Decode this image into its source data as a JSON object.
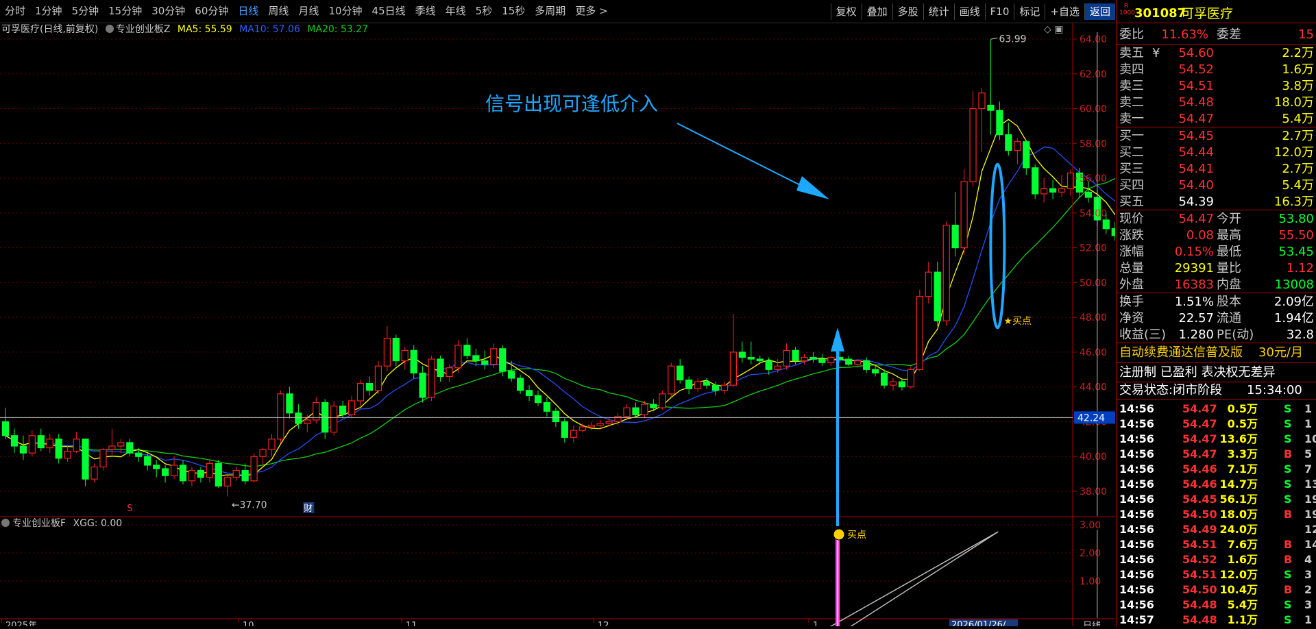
{
  "toolbar": {
    "periods": [
      {
        "label": "分时",
        "active": false
      },
      {
        "label": "1分钟",
        "active": false
      },
      {
        "label": "5分钟",
        "active": false
      },
      {
        "label": "15分钟",
        "active": false
      },
      {
        "label": "30分钟",
        "active": false
      },
      {
        "label": "60分钟",
        "active": false
      },
      {
        "label": "日线",
        "active": true
      },
      {
        "label": "周线",
        "active": false
      },
      {
        "label": "月线",
        "active": false
      },
      {
        "label": "10分钟",
        "active": false
      },
      {
        "label": "45日线",
        "active": false
      },
      {
        "label": "季线",
        "active": false
      },
      {
        "label": "年线",
        "active": false
      },
      {
        "label": "5秒",
        "active": false
      },
      {
        "label": "15秒",
        "active": false
      },
      {
        "label": "多周期",
        "active": false
      },
      {
        "label": "更多 >",
        "active": false
      }
    ],
    "buttons": [
      "复权",
      "叠加",
      "多股",
      "统计",
      "画线",
      "F10",
      "标记",
      "+自选",
      "返回"
    ]
  },
  "main_chart": {
    "title": "可孚医疗(日线,前复权)",
    "indicator_name": "专业创业板Z",
    "ma5_label": "MA5: 55.59",
    "ma10_label": "MA10: 57.06",
    "ma20_label": "MA20: 53.27",
    "high_annotation": "63.99",
    "low_annotation": "37.70",
    "buy_label": "★买点",
    "signal_text": "信号出现可逢低介入",
    "crosshair_price": "42.24",
    "s_marker": "S",
    "cai_marker": "财",
    "y_ticks": [
      "64.00",
      "62.00",
      "60.00",
      "58.00",
      "56.00",
      "54.00",
      "52.00",
      "50.00",
      "48.00",
      "46.00",
      "44.00",
      "42.00",
      "40.00",
      "38.00"
    ]
  },
  "sub_chart": {
    "title": "专业创业板F",
    "xgg_label": "XGG: 0.00",
    "buy_label": "买点",
    "y_ticks": [
      "3.00",
      "2.00",
      "1.00"
    ]
  },
  "x_axis": {
    "labels": [
      "2025年",
      "10",
      "11",
      "12",
      "1",
      "2026/01/26/"
    ],
    "right_label": "日线"
  },
  "colors": {
    "up": "#ff2020",
    "down": "#00ff30",
    "ma5": "#ffff00",
    "ma10": "#2050ff",
    "ma20": "#10d010",
    "arrow": "#1ea8ff",
    "signal_bar": "#ff20ff"
  },
  "chart_data": {
    "type": "candlestick",
    "ylim": [
      37,
      64.5
    ],
    "candles": [
      {
        "o": 42.0,
        "h": 42.8,
        "l": 41.0,
        "c": 41.2
      },
      {
        "o": 41.2,
        "h": 41.6,
        "l": 40.2,
        "c": 40.6
      },
      {
        "o": 40.6,
        "h": 41.2,
        "l": 39.8,
        "c": 40.2
      },
      {
        "o": 40.2,
        "h": 41.5,
        "l": 40.0,
        "c": 41.2
      },
      {
        "o": 41.2,
        "h": 41.6,
        "l": 40.3,
        "c": 40.5
      },
      {
        "o": 40.5,
        "h": 41.3,
        "l": 40.2,
        "c": 41.0
      },
      {
        "o": 41.0,
        "h": 41.3,
        "l": 39.6,
        "c": 39.9
      },
      {
        "o": 39.9,
        "h": 40.6,
        "l": 39.7,
        "c": 40.3
      },
      {
        "o": 40.3,
        "h": 41.4,
        "l": 40.2,
        "c": 41.0
      },
      {
        "o": 41.0,
        "h": 41.0,
        "l": 38.3,
        "c": 38.7
      },
      {
        "o": 38.7,
        "h": 39.6,
        "l": 38.5,
        "c": 39.4
      },
      {
        "o": 39.4,
        "h": 40.5,
        "l": 39.2,
        "c": 40.4
      },
      {
        "o": 40.4,
        "h": 41.6,
        "l": 40.1,
        "c": 40.6
      },
      {
        "o": 40.6,
        "h": 41.0,
        "l": 40.2,
        "c": 40.8
      },
      {
        "o": 40.8,
        "h": 41.0,
        "l": 40.0,
        "c": 40.2
      },
      {
        "o": 40.2,
        "h": 40.5,
        "l": 39.7,
        "c": 40.0
      },
      {
        "o": 40.0,
        "h": 40.2,
        "l": 39.2,
        "c": 39.5
      },
      {
        "o": 39.5,
        "h": 39.8,
        "l": 38.8,
        "c": 39.3
      },
      {
        "o": 39.3,
        "h": 39.5,
        "l": 38.5,
        "c": 38.9
      },
      {
        "o": 38.9,
        "h": 40.0,
        "l": 38.7,
        "c": 39.5
      },
      {
        "o": 39.5,
        "h": 39.8,
        "l": 38.4,
        "c": 38.6
      },
      {
        "o": 38.6,
        "h": 39.4,
        "l": 38.3,
        "c": 39.2
      },
      {
        "o": 39.2,
        "h": 39.4,
        "l": 38.5,
        "c": 38.8
      },
      {
        "o": 38.8,
        "h": 39.8,
        "l": 38.5,
        "c": 39.6
      },
      {
        "o": 39.6,
        "h": 39.8,
        "l": 38.2,
        "c": 38.3
      },
      {
        "o": 38.3,
        "h": 39.0,
        "l": 37.7,
        "c": 38.8
      },
      {
        "o": 38.8,
        "h": 39.4,
        "l": 38.6,
        "c": 39.2
      },
      {
        "o": 39.2,
        "h": 39.6,
        "l": 38.4,
        "c": 38.6
      },
      {
        "o": 38.6,
        "h": 40.2,
        "l": 38.5,
        "c": 40.0
      },
      {
        "o": 40.0,
        "h": 40.5,
        "l": 39.5,
        "c": 40.4
      },
      {
        "o": 40.4,
        "h": 41.3,
        "l": 40.0,
        "c": 41.0
      },
      {
        "o": 41.0,
        "h": 43.8,
        "l": 40.8,
        "c": 43.6
      },
      {
        "o": 43.6,
        "h": 44.0,
        "l": 42.2,
        "c": 42.5
      },
      {
        "o": 42.5,
        "h": 43.0,
        "l": 41.6,
        "c": 41.9
      },
      {
        "o": 41.9,
        "h": 42.4,
        "l": 41.4,
        "c": 42.1
      },
      {
        "o": 42.1,
        "h": 43.4,
        "l": 41.9,
        "c": 43.1
      },
      {
        "o": 43.1,
        "h": 43.3,
        "l": 41.0,
        "c": 41.4
      },
      {
        "o": 41.4,
        "h": 43.2,
        "l": 41.2,
        "c": 42.9
      },
      {
        "o": 42.9,
        "h": 43.2,
        "l": 42.2,
        "c": 42.4
      },
      {
        "o": 42.4,
        "h": 43.5,
        "l": 42.2,
        "c": 43.2
      },
      {
        "o": 43.2,
        "h": 44.4,
        "l": 42.9,
        "c": 44.2
      },
      {
        "o": 44.2,
        "h": 44.6,
        "l": 43.5,
        "c": 43.8
      },
      {
        "o": 43.8,
        "h": 45.5,
        "l": 43.6,
        "c": 45.2
      },
      {
        "o": 45.2,
        "h": 47.5,
        "l": 44.9,
        "c": 46.8
      },
      {
        "o": 46.8,
        "h": 47.0,
        "l": 45.2,
        "c": 45.5
      },
      {
        "o": 45.5,
        "h": 46.3,
        "l": 45.0,
        "c": 46.1
      },
      {
        "o": 46.1,
        "h": 46.4,
        "l": 44.5,
        "c": 44.8
      },
      {
        "o": 44.8,
        "h": 45.2,
        "l": 43.1,
        "c": 43.4
      },
      {
        "o": 43.4,
        "h": 45.8,
        "l": 43.2,
        "c": 45.6
      },
      {
        "o": 45.6,
        "h": 45.8,
        "l": 44.3,
        "c": 44.6
      },
      {
        "o": 44.6,
        "h": 45.3,
        "l": 44.3,
        "c": 45.1
      },
      {
        "o": 45.1,
        "h": 46.7,
        "l": 44.8,
        "c": 46.4
      },
      {
        "o": 46.4,
        "h": 46.8,
        "l": 45.6,
        "c": 45.8
      },
      {
        "o": 45.8,
        "h": 46.2,
        "l": 45.2,
        "c": 45.5
      },
      {
        "o": 45.5,
        "h": 46.1,
        "l": 45.0,
        "c": 45.3
      },
      {
        "o": 45.3,
        "h": 46.5,
        "l": 45.1,
        "c": 46.2
      },
      {
        "o": 46.2,
        "h": 46.4,
        "l": 44.6,
        "c": 44.9
      },
      {
        "o": 44.9,
        "h": 45.5,
        "l": 44.3,
        "c": 44.5
      },
      {
        "o": 44.5,
        "h": 44.7,
        "l": 43.6,
        "c": 43.8
      },
      {
        "o": 43.8,
        "h": 44.1,
        "l": 43.2,
        "c": 43.5
      },
      {
        "o": 43.5,
        "h": 43.8,
        "l": 42.9,
        "c": 43.1
      },
      {
        "o": 43.1,
        "h": 43.4,
        "l": 42.3,
        "c": 42.6
      },
      {
        "o": 42.6,
        "h": 42.8,
        "l": 41.7,
        "c": 42.0
      },
      {
        "o": 42.0,
        "h": 42.2,
        "l": 40.8,
        "c": 41.1
      },
      {
        "o": 41.1,
        "h": 41.8,
        "l": 40.8,
        "c": 41.5
      },
      {
        "o": 41.5,
        "h": 41.9,
        "l": 41.4,
        "c": 41.7
      },
      {
        "o": 41.7,
        "h": 42.0,
        "l": 41.5,
        "c": 41.8
      },
      {
        "o": 41.8,
        "h": 42.1,
        "l": 41.6,
        "c": 41.9
      },
      {
        "o": 41.9,
        "h": 42.2,
        "l": 41.7,
        "c": 42.0
      },
      {
        "o": 42.0,
        "h": 42.5,
        "l": 41.8,
        "c": 42.3
      },
      {
        "o": 42.3,
        "h": 43.0,
        "l": 42.1,
        "c": 42.8
      },
      {
        "o": 42.8,
        "h": 43.1,
        "l": 42.3,
        "c": 42.4
      },
      {
        "o": 42.4,
        "h": 43.2,
        "l": 42.2,
        "c": 43.0
      },
      {
        "o": 43.0,
        "h": 43.3,
        "l": 42.6,
        "c": 42.8
      },
      {
        "o": 42.8,
        "h": 43.8,
        "l": 42.7,
        "c": 43.6
      },
      {
        "o": 43.6,
        "h": 45.4,
        "l": 43.4,
        "c": 45.2
      },
      {
        "o": 45.2,
        "h": 45.6,
        "l": 44.2,
        "c": 44.4
      },
      {
        "o": 44.4,
        "h": 44.6,
        "l": 43.6,
        "c": 43.9
      },
      {
        "o": 43.9,
        "h": 44.5,
        "l": 43.7,
        "c": 44.3
      },
      {
        "o": 44.3,
        "h": 44.5,
        "l": 43.9,
        "c": 44.1
      },
      {
        "o": 44.1,
        "h": 44.3,
        "l": 43.5,
        "c": 43.8
      },
      {
        "o": 43.8,
        "h": 44.3,
        "l": 43.6,
        "c": 44.1
      },
      {
        "o": 44.1,
        "h": 48.2,
        "l": 44.0,
        "c": 46.0
      },
      {
        "o": 46.0,
        "h": 46.6,
        "l": 45.4,
        "c": 45.7
      },
      {
        "o": 45.7,
        "h": 46.6,
        "l": 45.3,
        "c": 45.6
      },
      {
        "o": 45.6,
        "h": 45.8,
        "l": 45.3,
        "c": 45.5
      },
      {
        "o": 45.5,
        "h": 45.7,
        "l": 44.7,
        "c": 45.0
      },
      {
        "o": 45.0,
        "h": 45.6,
        "l": 44.8,
        "c": 45.2
      },
      {
        "o": 45.2,
        "h": 46.5,
        "l": 45.0,
        "c": 46.1
      },
      {
        "o": 46.1,
        "h": 46.3,
        "l": 45.3,
        "c": 45.5
      },
      {
        "o": 45.5,
        "h": 45.9,
        "l": 45.3,
        "c": 45.7
      },
      {
        "o": 45.7,
        "h": 46.0,
        "l": 45.4,
        "c": 45.6
      },
      {
        "o": 45.6,
        "h": 45.9,
        "l": 45.2,
        "c": 45.4
      },
      {
        "o": 45.4,
        "h": 45.8,
        "l": 45.2,
        "c": 45.7
      },
      {
        "o": 45.7,
        "h": 46.0,
        "l": 45.4,
        "c": 45.6
      },
      {
        "o": 45.6,
        "h": 45.8,
        "l": 45.2,
        "c": 45.3
      },
      {
        "o": 45.3,
        "h": 45.6,
        "l": 45.1,
        "c": 45.5
      },
      {
        "o": 45.5,
        "h": 45.7,
        "l": 44.8,
        "c": 45.0
      },
      {
        "o": 45.0,
        "h": 45.3,
        "l": 44.6,
        "c": 44.8
      },
      {
        "o": 44.8,
        "h": 45.0,
        "l": 43.9,
        "c": 44.1
      },
      {
        "o": 44.1,
        "h": 44.5,
        "l": 43.8,
        "c": 44.3
      },
      {
        "o": 44.3,
        "h": 44.5,
        "l": 43.8,
        "c": 44.0
      },
      {
        "o": 44.0,
        "h": 45.2,
        "l": 43.9,
        "c": 45.0
      },
      {
        "o": 45.0,
        "h": 49.6,
        "l": 44.9,
        "c": 49.2
      },
      {
        "o": 49.2,
        "h": 51.2,
        "l": 48.8,
        "c": 50.6
      },
      {
        "o": 50.6,
        "h": 51.2,
        "l": 47.5,
        "c": 47.8
      },
      {
        "o": 47.8,
        "h": 53.5,
        "l": 47.5,
        "c": 53.3
      },
      {
        "o": 53.3,
        "h": 55.2,
        "l": 51.5,
        "c": 52.0
      },
      {
        "o": 52.0,
        "h": 56.5,
        "l": 51.6,
        "c": 55.8
      },
      {
        "o": 55.8,
        "h": 61.0,
        "l": 55.5,
        "c": 60.0
      },
      {
        "o": 60.0,
        "h": 61.2,
        "l": 57.5,
        "c": 60.9
      },
      {
        "o": 60.2,
        "h": 63.99,
        "l": 58.5,
        "c": 59.9
      },
      {
        "o": 59.9,
        "h": 60.4,
        "l": 58.2,
        "c": 58.5
      },
      {
        "o": 58.5,
        "h": 59.2,
        "l": 57.3,
        "c": 57.6
      },
      {
        "o": 57.6,
        "h": 58.3,
        "l": 56.8,
        "c": 58.1
      },
      {
        "o": 58.1,
        "h": 58.2,
        "l": 56.2,
        "c": 56.6
      },
      {
        "o": 56.6,
        "h": 56.8,
        "l": 54.8,
        "c": 55.1
      },
      {
        "o": 55.1,
        "h": 56.0,
        "l": 54.6,
        "c": 55.4
      },
      {
        "o": 55.4,
        "h": 55.9,
        "l": 54.8,
        "c": 55.2
      },
      {
        "o": 55.2,
        "h": 56.2,
        "l": 54.9,
        "c": 55.4
      },
      {
        "o": 55.4,
        "h": 56.5,
        "l": 55.0,
        "c": 56.3
      },
      {
        "o": 56.3,
        "h": 56.6,
        "l": 54.9,
        "c": 55.2
      },
      {
        "o": 55.2,
        "h": 55.8,
        "l": 54.6,
        "c": 54.9
      },
      {
        "o": 54.9,
        "h": 55.3,
        "l": 53.3,
        "c": 53.6
      },
      {
        "o": 53.6,
        "h": 54.0,
        "l": 52.8,
        "c": 53.1
      },
      {
        "o": 53.1,
        "h": 53.5,
        "l": 52.4,
        "c": 52.7
      },
      {
        "o": 52.7,
        "h": 53.0,
        "l": 51.9,
        "c": 52.2
      },
      {
        "o": 52.2,
        "h": 52.4,
        "l": 51.0,
        "c": 51.2
      },
      {
        "o": 51.2,
        "h": 52.6,
        "l": 51.0,
        "c": 52.4
      },
      {
        "o": 52.4,
        "h": 53.7,
        "l": 52.2,
        "c": 53.5
      },
      {
        "o": 53.5,
        "h": 54.3,
        "l": 53.2,
        "c": 54.1
      },
      {
        "o": 54.1,
        "h": 55.5,
        "l": 53.45,
        "c": 54.47
      }
    ],
    "signal_index": 112,
    "signal_value": 3.0
  },
  "quote": {
    "code": "301087",
    "name": "可孚医疗",
    "badge_top": "R",
    "badge_bottom": "1000",
    "weibi_label": "委比",
    "weibi_value": "11.63%",
    "weicha_label": "委差",
    "weicha_value": "15",
    "asks": [
      {
        "label": "卖五",
        "mark": "¥",
        "price": "54.60",
        "vol": "2.2万"
      },
      {
        "label": "卖四",
        "mark": "",
        "price": "54.52",
        "vol": "1.6万"
      },
      {
        "label": "卖三",
        "mark": "",
        "price": "54.51",
        "vol": "3.8万"
      },
      {
        "label": "卖二",
        "mark": "",
        "price": "54.48",
        "vol": "18.0万"
      },
      {
        "label": "卖一",
        "mark": "",
        "price": "54.47",
        "vol": "5.4万"
      }
    ],
    "bids": [
      {
        "label": "买一",
        "price": "54.45",
        "vol": "2.7万",
        "price_color": "#ff3030"
      },
      {
        "label": "买二",
        "price": "54.44",
        "vol": "12.0万",
        "price_color": "#ff3030"
      },
      {
        "label": "买三",
        "price": "54.41",
        "vol": "2.7万",
        "price_color": "#ff3030"
      },
      {
        "label": "买四",
        "price": "54.40",
        "vol": "5.4万",
        "price_color": "#ff3030"
      },
      {
        "label": "买五",
        "price": "54.39",
        "vol": "16.3万",
        "price_color": "#ffffff"
      }
    ],
    "stats": [
      {
        "l1": "现价",
        "v1": "54.47",
        "c1": "#ff3030",
        "l2": "今开",
        "v2": "53.80",
        "c2": "#00ff30"
      },
      {
        "l1": "涨跌",
        "v1": "0.08",
        "c1": "#ff3030",
        "l2": "最高",
        "v2": "55.50",
        "c2": "#ff3030"
      },
      {
        "l1": "涨幅",
        "v1": "0.15%",
        "c1": "#ff3030",
        "l2": "最低",
        "v2": "53.45",
        "c2": "#00ff30"
      },
      {
        "l1": "总量",
        "v1": "29391",
        "c1": "#ffff00",
        "l2": "量比",
        "v2": "1.12",
        "c2": "#ff3030"
      },
      {
        "l1": "外盘",
        "v1": "16383",
        "c1": "#ff3030",
        "l2": "内盘",
        "v2": "13008",
        "c2": "#00ff30"
      }
    ],
    "fund": [
      {
        "l1": "换手",
        "v1": "1.51%",
        "l2": "股本",
        "v2": "2.09亿"
      },
      {
        "l1": "净资",
        "v1": "22.57",
        "l2": "流通",
        "v2": "1.94亿"
      },
      {
        "l1": "收益(三)",
        "v1": "1.280",
        "l2": "PE(动)",
        "v2": "32.8"
      }
    ],
    "promo_text": "自动续费通达信普及版",
    "promo_price": "30元/月",
    "reg_text": "注册制 已盈利 表决权无差异",
    "trade_status": "交易状态:闭市阶段",
    "trade_time": "15:34:00",
    "ticks": [
      {
        "t": "14:56",
        "p": "54.47",
        "v": "0.5万",
        "bs": "S",
        "n": "1"
      },
      {
        "t": "14:56",
        "p": "54.47",
        "v": "0.5万",
        "bs": "S",
        "n": "1"
      },
      {
        "t": "14:56",
        "p": "54.47",
        "v": "13.6万",
        "bs": "S",
        "n": "10"
      },
      {
        "t": "14:56",
        "p": "54.47",
        "v": "3.3万",
        "bs": "B",
        "n": "5"
      },
      {
        "t": "14:56",
        "p": "54.46",
        "v": "7.1万",
        "bs": "S",
        "n": "7"
      },
      {
        "t": "14:56",
        "p": "54.46",
        "v": "14.7万",
        "bs": "S",
        "n": "13"
      },
      {
        "t": "14:56",
        "p": "54.45",
        "v": "56.1万",
        "bs": "S",
        "n": "19"
      },
      {
        "t": "14:56",
        "p": "54.50",
        "v": "18.0万",
        "bs": "B",
        "n": "19"
      },
      {
        "t": "14:56",
        "p": "54.49",
        "v": "24.0万",
        "bs": "",
        "n": "12"
      },
      {
        "t": "14:56",
        "p": "54.51",
        "v": "7.6万",
        "bs": "B",
        "n": "14"
      },
      {
        "t": "14:56",
        "p": "54.52",
        "v": "1.6万",
        "bs": "B",
        "n": "4"
      },
      {
        "t": "14:56",
        "p": "54.51",
        "v": "12.0万",
        "bs": "S",
        "n": "3"
      },
      {
        "t": "14:56",
        "p": "54.50",
        "v": "10.4万",
        "bs": "B",
        "n": "2"
      },
      {
        "t": "14:56",
        "p": "54.48",
        "v": "5.4万",
        "bs": "S",
        "n": "3"
      },
      {
        "t": "14:57",
        "p": "54.48",
        "v": "1.1万",
        "bs": "S",
        "n": "1"
      }
    ]
  }
}
